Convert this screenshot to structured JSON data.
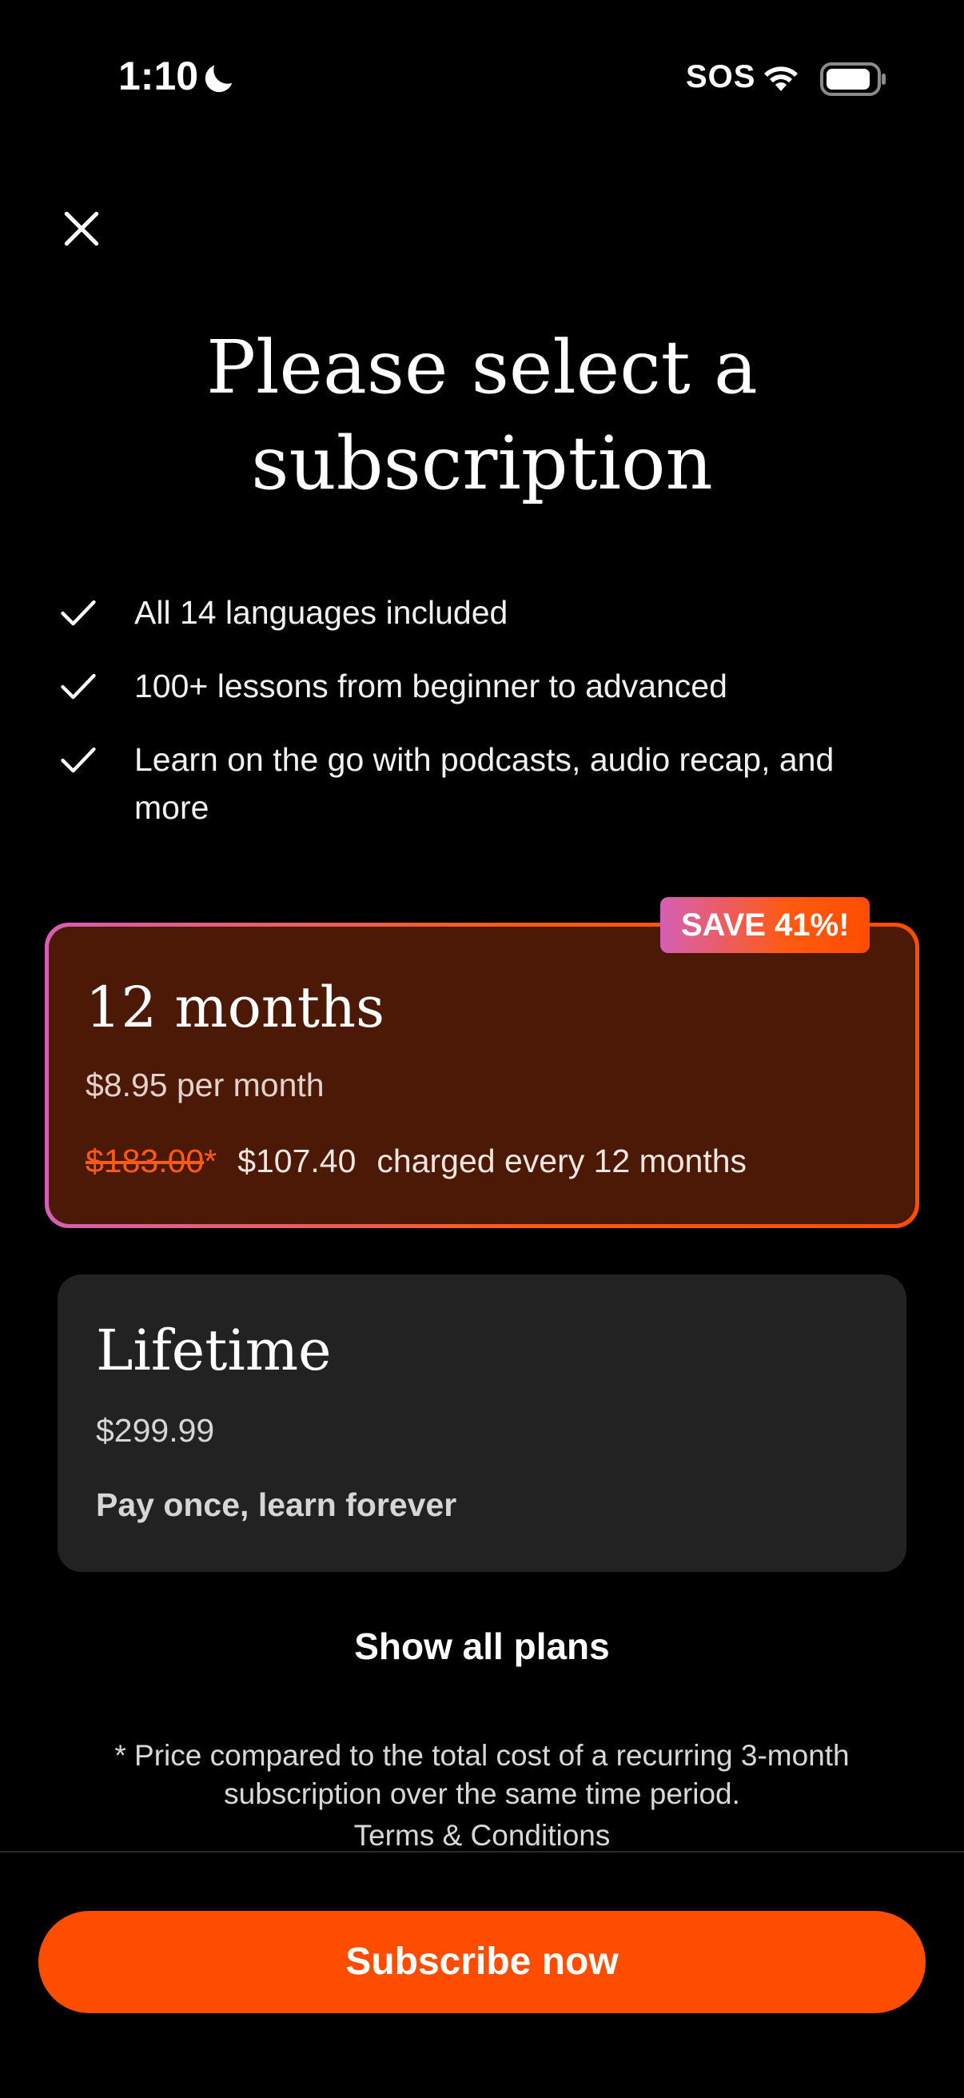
{
  "status_bar": {
    "time": "1:10",
    "focus_icon": "moon-icon",
    "sos": "SOS",
    "wifi_icon": "wifi-icon",
    "battery_icon": "battery-icon"
  },
  "close_icon": "close-icon",
  "title": "Please select a subscription",
  "features": [
    {
      "icon": "check-icon",
      "text": "All 14 languages included"
    },
    {
      "icon": "check-icon",
      "text": "100+ lessons from beginner to advanced"
    },
    {
      "icon": "check-icon",
      "text": "Learn on the go with podcasts, audio recap, and more"
    }
  ],
  "plans": {
    "twelve_months": {
      "badge": "SAVE 41%!",
      "name": "12 months",
      "per_month": "$8.95 per month",
      "old_price": "$183.00",
      "asterisk": "*",
      "price": "$107.40",
      "billing": "charged every 12 months",
      "selected": true
    },
    "lifetime": {
      "name": "Lifetime",
      "price": "$299.99",
      "subtitle": "Pay once, learn forever",
      "selected": false
    }
  },
  "show_all_plans": "Show all plans",
  "footnote": "* Price compared to the total cost of a recurring 3-month subscription over the same time period.",
  "terms_link": "Terms & Conditions",
  "subscribe_button": "Subscribe now",
  "colors": {
    "accent": "#ff4d00",
    "gradient_start": "#d65fb5",
    "selected_card_bg": "#4c1906",
    "card_bg": "#222222",
    "background": "#000000"
  }
}
